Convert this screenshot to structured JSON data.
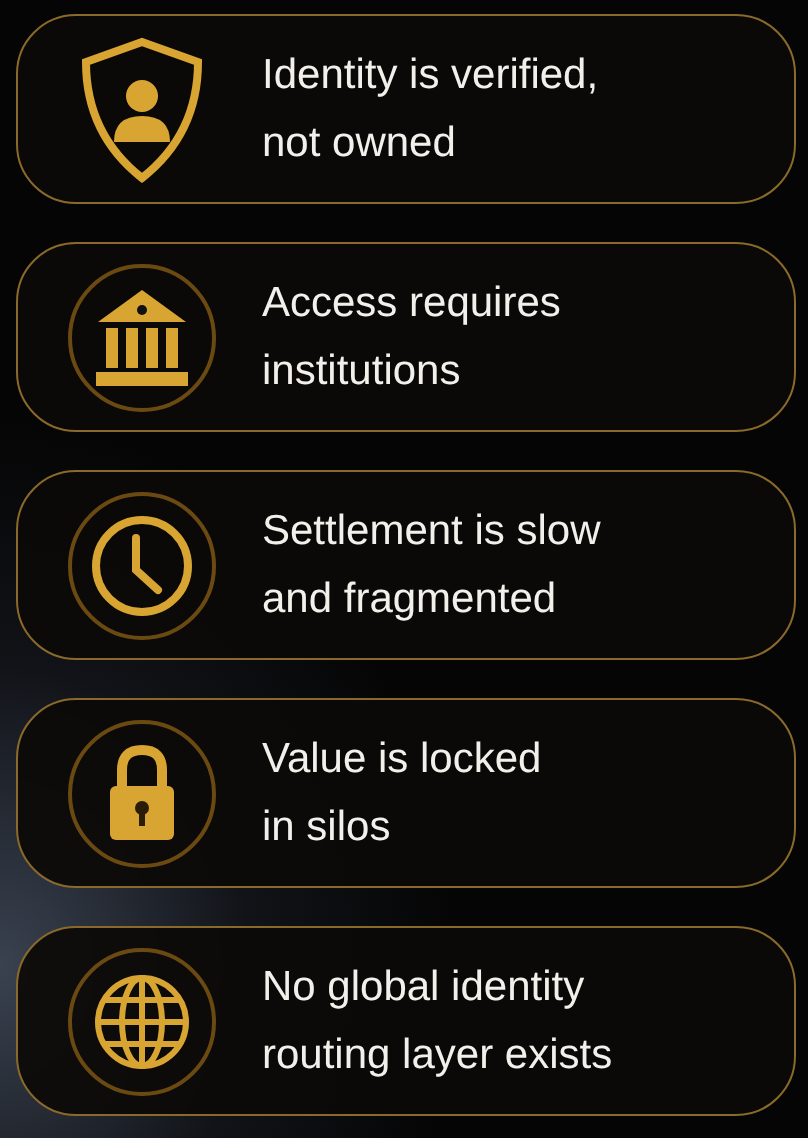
{
  "cards": [
    {
      "text": "Identity is verified,\nnot owned"
    },
    {
      "text": "Access requires\ninstitutions"
    },
    {
      "text": "Settlement is slow\nand fragmented"
    },
    {
      "text": "Value is locked\nin silos"
    },
    {
      "text": "No global identity\nrouting layer exists"
    }
  ]
}
